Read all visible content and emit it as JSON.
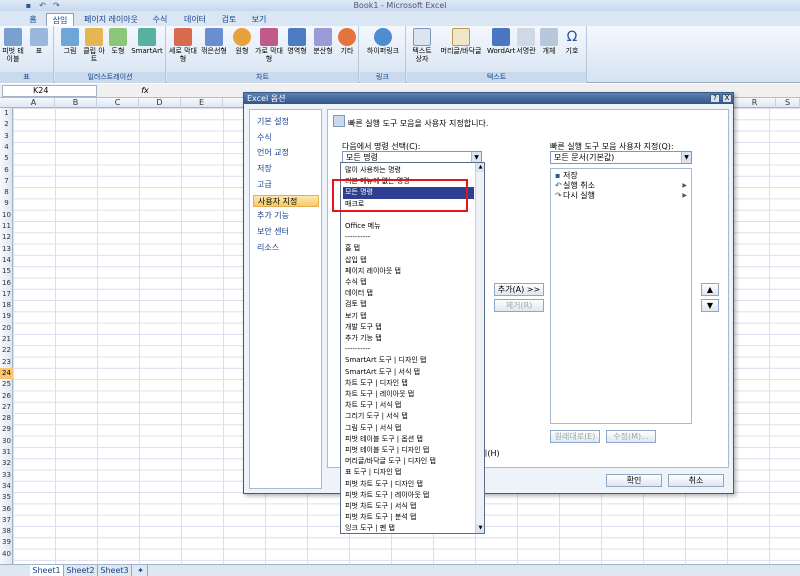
{
  "window": {
    "title": "Book1 - Microsoft Excel"
  },
  "tabs": [
    "홈",
    "삽입",
    "페이지 레이아웃",
    "수식",
    "데이터",
    "검토",
    "보기"
  ],
  "active_tab_index": 1,
  "ribbon": {
    "groups": [
      {
        "label": "표",
        "buttons": [
          "피벗 테이블",
          "표"
        ]
      },
      {
        "label": "일러스트레이션",
        "buttons": [
          "그림",
          "클립 아트",
          "도형",
          "SmartArt"
        ]
      },
      {
        "label": "차트",
        "buttons": [
          "세로 막대형",
          "꺾은선형",
          "원형",
          "가로 막대형",
          "영역형",
          "분산형",
          "기타"
        ]
      },
      {
        "label": "링크",
        "buttons": [
          "하이퍼링크"
        ]
      },
      {
        "label": "텍스트",
        "buttons": [
          "텍스트 상자",
          "머리글/바닥글",
          "WordArt",
          "서명란",
          "개체",
          "기호"
        ]
      }
    ]
  },
  "formula_bar": {
    "name_box": "K24",
    "fx": "fx"
  },
  "grid": {
    "columns": [
      "A",
      "B",
      "C",
      "D",
      "E",
      "R",
      "S"
    ],
    "rows": [
      "1",
      "2",
      "3",
      "4",
      "5",
      "6",
      "7",
      "8",
      "9",
      "10",
      "11",
      "12",
      "13",
      "14",
      "15",
      "16",
      "17",
      "18",
      "19",
      "20",
      "21",
      "22",
      "23",
      "24",
      "25",
      "26",
      "27",
      "28",
      "29",
      "30",
      "31",
      "32",
      "33",
      "34",
      "35",
      "36",
      "37",
      "38",
      "39",
      "40"
    ],
    "selected_row": "24"
  },
  "sheets": [
    "Sheet1",
    "Sheet2",
    "Sheet3"
  ],
  "dialog": {
    "title": "Excel 옵션",
    "help_button": "?",
    "close_button": "X",
    "nav_items": [
      "기본 설정",
      "수식",
      "언어 교정",
      "저장",
      "고급",
      "사용자 지정",
      "추가 기능",
      "보안 센터",
      "리소스"
    ],
    "active_nav_index": 5,
    "heading": "빠른 실행 도구 모음을 사용자 지정합니다.",
    "choose_label": "다음에서 명령 선택(C):",
    "choose_value": "모든 명령",
    "customize_label": "빠른 실행 도구 모음 사용자 지정(Q):",
    "customize_value": "모든 문서(기본값)",
    "qa_items": [
      "저장",
      "실행 취소",
      "다시 실행"
    ],
    "add_button": "추가(A) >>",
    "remove_button": "제거(R)",
    "reset_button": "원래대로(E)",
    "modify_button": "수정(M)...",
    "show_below_suffix": "시(H)",
    "ok_button": "확인",
    "cancel_button": "취소",
    "up_glyph": "▲",
    "down_glyph": "▼"
  },
  "dropdown_list": [
    "많이 사용하는 명령",
    "리본 메뉴에 없는 명령",
    "모든 명령",
    "매크로",
    "",
    "Office 메뉴",
    "----------",
    "홈 탭",
    "삽입 탭",
    "페이지 레이아웃 탭",
    "수식 탭",
    "데이터 탭",
    "검토 탭",
    "보기 탭",
    "개발 도구 탭",
    "추가 기능 탭",
    "----------",
    "SmartArt 도구 | 디자인 탭",
    "SmartArt 도구 | 서식 탭",
    "차트 도구 | 디자인 탭",
    "차트 도구 | 레이아웃 탭",
    "차트 도구 | 서식 탭",
    "그리기 도구 | 서식 탭",
    "그림 도구 | 서식 탭",
    "피벗 테이블 도구 | 옵션 탭",
    "피벗 테이블 도구 | 디자인 탭",
    "머리글/바닥글 도구 | 디자인 탭",
    "표 도구 | 디자인 탭",
    "피벗 차트 도구 | 디자인 탭",
    "피벗 차트 도구 | 레이아웃 탭",
    "피벗 차트 도구 | 서식 탭",
    "피벗 차트 도구 | 분석 탭",
    "잉크 도구 | 펜 탭"
  ],
  "dropdown_highlight_index": 2,
  "colors": {
    "accent": "#2e3f91",
    "annotation": "#e8141c"
  }
}
